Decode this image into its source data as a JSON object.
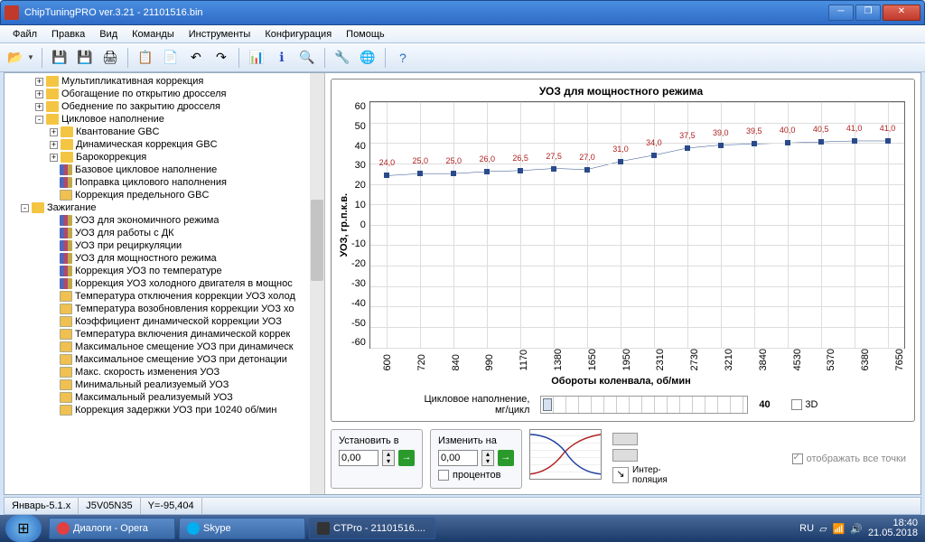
{
  "window": {
    "title": "ChipTuningPRO ver.3.21 - 21101516.bin"
  },
  "menu": {
    "file": "Файл",
    "edit": "Правка",
    "view": "Вид",
    "commands": "Команды",
    "tools": "Инструменты",
    "config": "Конфигурация",
    "help": "Помощь"
  },
  "tree": [
    {
      "d": 2,
      "e": "+",
      "i": "folder",
      "t": "Мультипликативная коррекция"
    },
    {
      "d": 2,
      "e": "+",
      "i": "folder",
      "t": "Обогащение по открытию дросселя"
    },
    {
      "d": 2,
      "e": "+",
      "i": "folder",
      "t": "Обеднение по закрытию дросселя"
    },
    {
      "d": 2,
      "e": "-",
      "i": "folder",
      "t": "Цикловое наполнение"
    },
    {
      "d": 3,
      "e": "+",
      "i": "folder",
      "t": "Квантование GBC"
    },
    {
      "d": 3,
      "e": "+",
      "i": "folder",
      "t": "Динамическая коррекция GBC"
    },
    {
      "d": 3,
      "e": "+",
      "i": "folder",
      "t": "Барокоррекция"
    },
    {
      "d": 3,
      "e": "",
      "i": "table",
      "t": "Базовое цикловое наполнение"
    },
    {
      "d": 3,
      "e": "",
      "i": "table",
      "t": "Поправка циклового наполнения"
    },
    {
      "d": 3,
      "e": "",
      "i": "val",
      "t": "Коррекция предельного GBC"
    },
    {
      "d": 1,
      "e": "-",
      "i": "folder",
      "t": "Зажигание"
    },
    {
      "d": 3,
      "e": "",
      "i": "table",
      "t": "УОЗ для экономичного режима"
    },
    {
      "d": 3,
      "e": "",
      "i": "table",
      "t": "УОЗ для работы с ДК"
    },
    {
      "d": 3,
      "e": "",
      "i": "table",
      "t": "УОЗ при рециркуляции"
    },
    {
      "d": 3,
      "e": "",
      "i": "table",
      "t": "УОЗ для мощностного режима"
    },
    {
      "d": 3,
      "e": "",
      "i": "table",
      "t": "Коррекция УОЗ по температуре"
    },
    {
      "d": 3,
      "e": "",
      "i": "table",
      "t": "Коррекция УОЗ холодного двигателя в мощнос"
    },
    {
      "d": 3,
      "e": "",
      "i": "val",
      "t": "Температура отключения коррекции УОЗ холод"
    },
    {
      "d": 3,
      "e": "",
      "i": "val",
      "t": "Температура возобновления коррекции УОЗ хо"
    },
    {
      "d": 3,
      "e": "",
      "i": "val",
      "t": "Коэффициент динамической коррекции УОЗ"
    },
    {
      "d": 3,
      "e": "",
      "i": "val",
      "t": "Температура включения динамической коррек"
    },
    {
      "d": 3,
      "e": "",
      "i": "val",
      "t": "Максимальное смещение УОЗ при динамическ"
    },
    {
      "d": 3,
      "e": "",
      "i": "val",
      "t": "Максимальное смещение УОЗ при детонации"
    },
    {
      "d": 3,
      "e": "",
      "i": "val",
      "t": "Макс. скорость изменения УОЗ"
    },
    {
      "d": 3,
      "e": "",
      "i": "val",
      "t": "Минимальный реализуемый УОЗ"
    },
    {
      "d": 3,
      "e": "",
      "i": "val",
      "t": "Максимальный реализуемый УОЗ"
    },
    {
      "d": 3,
      "e": "",
      "i": "val",
      "t": "Коррекция задержки УОЗ при 10240 об/мин"
    }
  ],
  "chart_data": {
    "type": "line",
    "title": "УОЗ для мощностного режима",
    "xlabel": "Обороты коленвала, об/мин",
    "ylabel": "УОЗ, гр.п.к.в.",
    "ylim": [
      -60,
      60
    ],
    "yticks": [
      60,
      50,
      40,
      30,
      20,
      10,
      0,
      -10,
      -20,
      -30,
      -40,
      -50,
      -60
    ],
    "categories": [
      "600",
      "720",
      "840",
      "990",
      "1170",
      "1380",
      "1650",
      "1950",
      "2310",
      "2730",
      "3210",
      "3840",
      "4530",
      "5370",
      "6380",
      "7650"
    ],
    "values": [
      24.0,
      25.0,
      25.0,
      26.0,
      26.5,
      27.5,
      27.0,
      31.0,
      34.0,
      37.5,
      39.0,
      39.5,
      40.0,
      40.5,
      41.0,
      41.0
    ]
  },
  "slider": {
    "label": "Цикловое наполнение,\nмг/цикл",
    "value": "40",
    "box3d": "3D"
  },
  "controls": {
    "set_label": "Установить в",
    "set_val": "0,00",
    "change_label": "Изменить на",
    "change_val": "0,00",
    "percent_label": "процентов",
    "interp_label": "Интер-\nполяция",
    "showall_label": "отображать все точки"
  },
  "status": {
    "cal": "Январь-5.1.x",
    "ver": "J5V05N35",
    "y": "Y=-95,404"
  },
  "taskbar": {
    "items": [
      "Диалоги - Opera",
      "Skype",
      "CTPro - 21101516...."
    ],
    "lang": "RU",
    "time": "18:40",
    "date": "21.05.2018"
  }
}
